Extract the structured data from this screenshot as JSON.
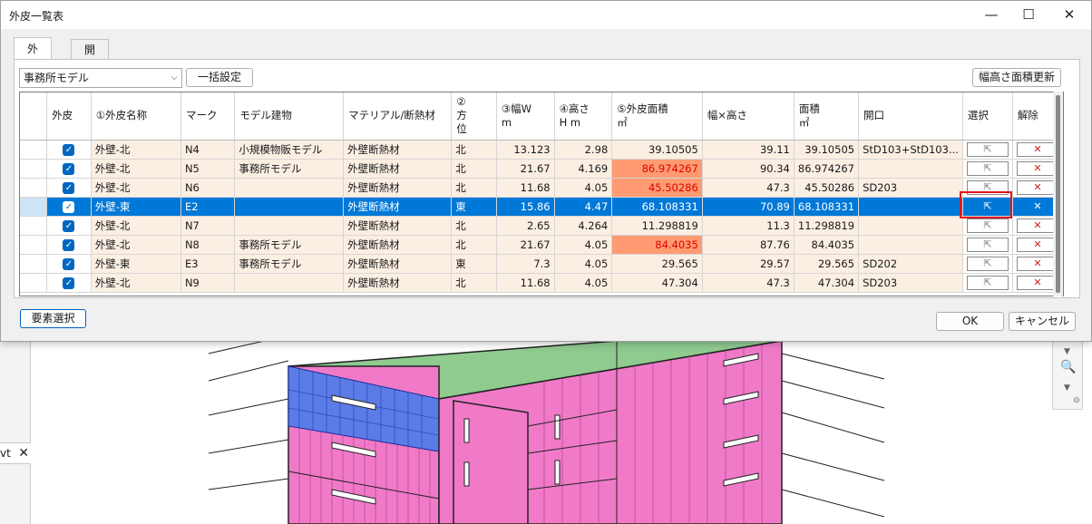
{
  "window": {
    "title": "外皮一覧表",
    "minimize": "—",
    "maximize": "☐",
    "close": "✕"
  },
  "tabs": [
    {
      "label": "外皮",
      "active": true
    },
    {
      "label": "開口",
      "active": false
    }
  ],
  "toolbar": {
    "model_select": "事務所モデル",
    "bulk_button": "一括設定",
    "update_button": "幅高さ面積更新"
  },
  "grid": {
    "columns": [
      "外皮",
      "①外皮名称",
      "マーク",
      "モデル建物",
      "マテリアル/断熱材",
      "②\n方\n位",
      "③幅W\nm",
      "④高さ\nH m",
      "⑤外皮面積\n㎡",
      "幅×高さ",
      "面積\n㎡",
      "開口",
      "選択",
      "解除"
    ],
    "rows": [
      {
        "name": "外壁-北",
        "mark": "N4",
        "model": "小規模物販モデル",
        "material": "外壁断熱材",
        "dir": "北",
        "w": "13.123",
        "h": "2.98",
        "area": "39.10505",
        "wh": "39.11",
        "area2": "39.10505",
        "opening": "StD103+StD103...",
        "highlight": false,
        "selected": false
      },
      {
        "name": "外壁-北",
        "mark": "N5",
        "model": "事務所モデル",
        "material": "外壁断熱材",
        "dir": "北",
        "w": "21.67",
        "h": "4.169",
        "area": "86.974267",
        "wh": "90.34",
        "area2": "86.974267",
        "opening": "",
        "highlight": true,
        "selected": false
      },
      {
        "name": "外壁-北",
        "mark": "N6",
        "model": "",
        "material": "外壁断熱材",
        "dir": "北",
        "w": "11.68",
        "h": "4.05",
        "area": "45.50286",
        "wh": "47.3",
        "area2": "45.50286",
        "opening": "SD203",
        "highlight": true,
        "selected": false
      },
      {
        "name": "外壁-東",
        "mark": "E2",
        "model": "",
        "material": "外壁断熱材",
        "dir": "東",
        "w": "15.86",
        "h": "4.47",
        "area": "68.108331",
        "wh": "70.89",
        "area2": "68.108331",
        "opening": "",
        "highlight": false,
        "selected": true
      },
      {
        "name": "外壁-北",
        "mark": "N7",
        "model": "",
        "material": "外壁断熱材",
        "dir": "北",
        "w": "2.65",
        "h": "4.264",
        "area": "11.298819",
        "wh": "11.3",
        "area2": "11.298819",
        "opening": "",
        "highlight": false,
        "selected": false
      },
      {
        "name": "外壁-北",
        "mark": "N8",
        "model": "事務所モデル",
        "material": "外壁断熱材",
        "dir": "北",
        "w": "21.67",
        "h": "4.05",
        "area": "84.4035",
        "wh": "87.76",
        "area2": "84.4035",
        "opening": "",
        "highlight": true,
        "selected": false
      },
      {
        "name": "外壁-東",
        "mark": "E3",
        "model": "事務所モデル",
        "material": "外壁断熱材",
        "dir": "東",
        "w": "7.3",
        "h": "4.05",
        "area": "29.565",
        "wh": "29.57",
        "area2": "29.565",
        "opening": "SD202",
        "highlight": false,
        "selected": false
      },
      {
        "name": "外壁-北",
        "mark": "N9",
        "model": "",
        "material": "外壁断熱材",
        "dir": "北",
        "w": "11.68",
        "h": "4.05",
        "area": "47.304",
        "wh": "47.3",
        "area2": "47.304",
        "opening": "SD203",
        "highlight": false,
        "selected": false
      }
    ],
    "check_glyph": "✓",
    "select_glyph": "⇱",
    "delete_glyph": "✕"
  },
  "footer": {
    "element_select": "要素選択",
    "ok": "OK",
    "cancel": "キャンセル"
  },
  "background": {
    "side_tab_label": "vt",
    "side_tab_close": "✕"
  },
  "colors": {
    "accent": "#0078d7",
    "row_bg": "#fbefe3",
    "highlight_cell": "#ff9b73",
    "highlight_text": "#e00000",
    "building_pink": "#f07ac8",
    "roof_green": "#8cc68c",
    "glass_blue": "#4a6fe0",
    "selection_box": "#e0141e"
  }
}
